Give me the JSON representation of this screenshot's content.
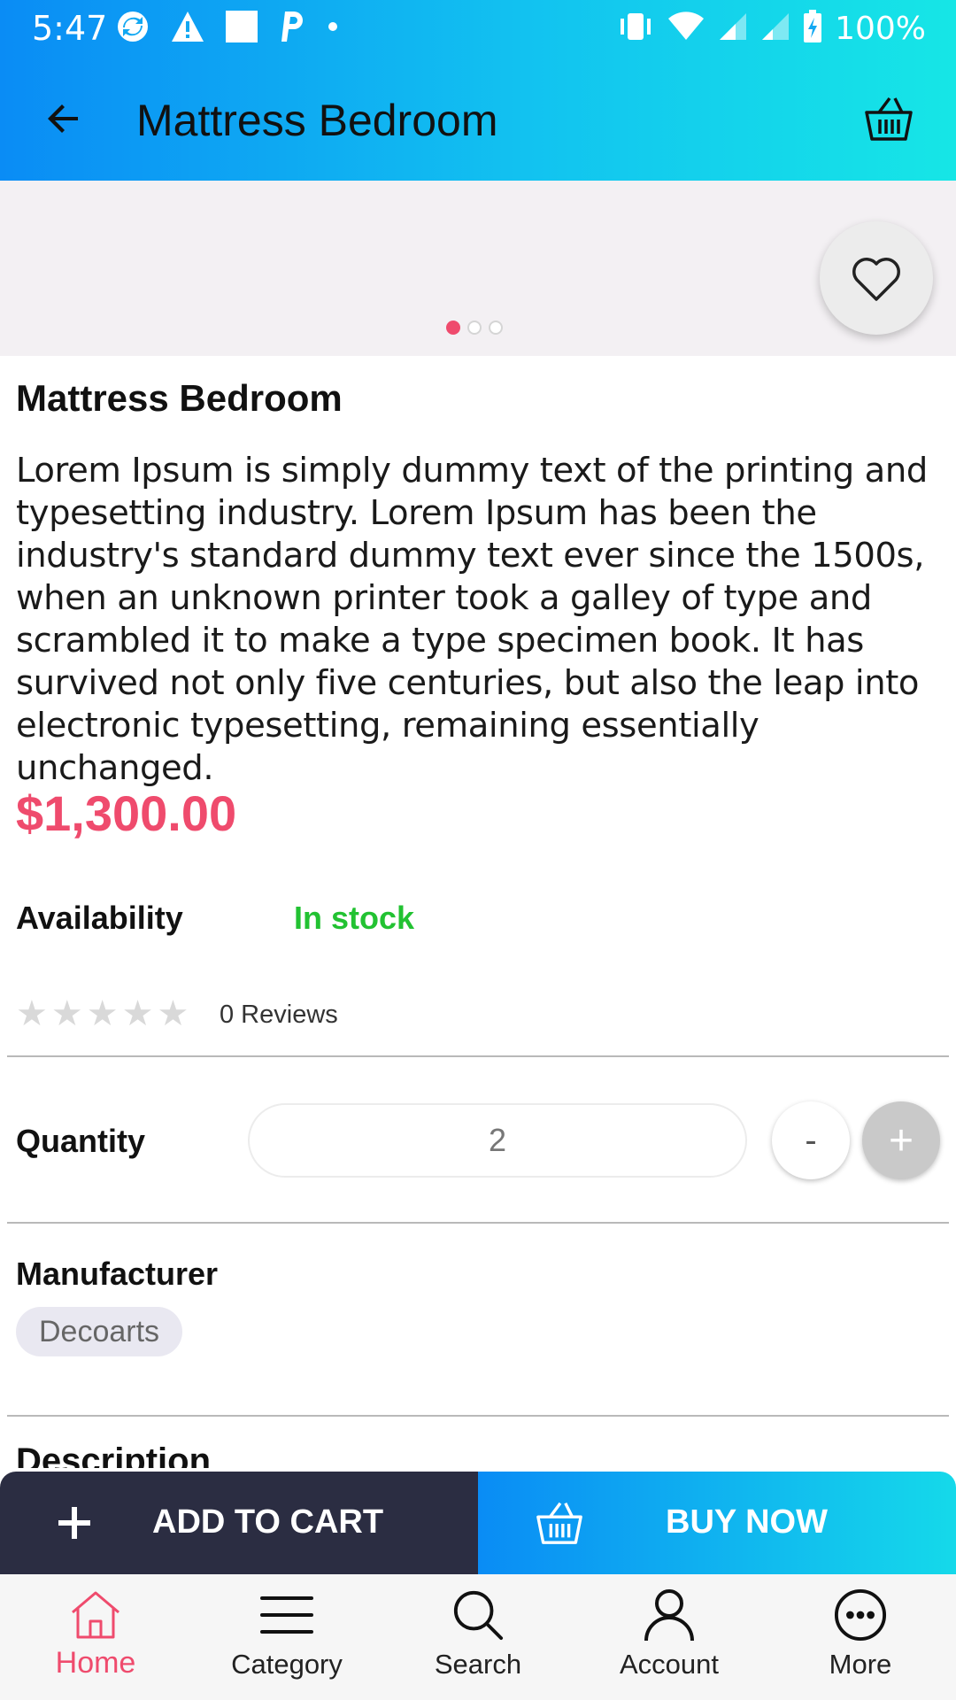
{
  "status_bar": {
    "time": "5:47",
    "battery": "100%",
    "icons": [
      "sync-icon",
      "warning-icon",
      "square-notification-icon",
      "parking-icon",
      "dot-icon",
      "vibrate-icon",
      "wifi-icon",
      "signal-icon",
      "signal-icon",
      "battery-charging-icon"
    ]
  },
  "app_bar": {
    "title": "Mattress Bedroom",
    "back_icon": "arrow-left-icon",
    "cart_icon": "basket-icon"
  },
  "carousel": {
    "slide_count": 3,
    "active_index": 0,
    "favorite_icon": "heart-outline-icon"
  },
  "product": {
    "name": "Mattress Bedroom",
    "description": "Lorem Ipsum is simply dummy text of the printing and typesetting industry. Lorem Ipsum has been the industry's standard dummy text ever since the 1500s, when an unknown printer took a galley of type and scrambled it to make a type specimen book. It has survived not only five centuries, but also the leap into electronic typesetting, remaining essentially unchanged.",
    "price": "$1,300.00",
    "availability_label": "Availability",
    "availability_value": "In stock",
    "rating": 0,
    "max_rating": 5,
    "reviews": "0 Reviews"
  },
  "quantity": {
    "label": "Quantity",
    "value": "2",
    "minus_label": "-",
    "plus_label": "+"
  },
  "manufacturer": {
    "label": "Manufacturer",
    "value": "Decoarts"
  },
  "description_section": {
    "heading": "Description"
  },
  "actions": {
    "add_to_cart": "ADD TO CART",
    "buy_now": "BUY NOW"
  },
  "bottom_nav": {
    "items": [
      {
        "label": "Home",
        "icon": "home-icon",
        "active": true
      },
      {
        "label": "Category",
        "icon": "menu-lines-icon",
        "active": false
      },
      {
        "label": "Search",
        "icon": "search-icon",
        "active": false
      },
      {
        "label": "Account",
        "icon": "person-icon",
        "active": false
      },
      {
        "label": "More",
        "icon": "more-dots-icon",
        "active": false
      }
    ]
  },
  "colors": {
    "accent": "#ef4b6d",
    "in_stock": "#22c232",
    "gradient_start": "#0a8cf5",
    "gradient_end": "#16e6e6",
    "add_to_cart_bg": "#2b2d42"
  }
}
